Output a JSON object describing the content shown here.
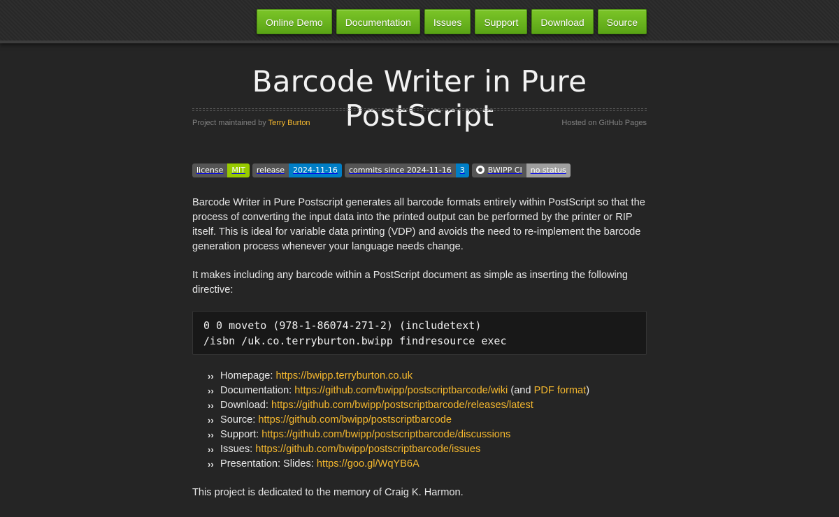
{
  "nav": [
    {
      "label": "Online Demo"
    },
    {
      "label": "Documentation"
    },
    {
      "label": "Issues"
    },
    {
      "label": "Support"
    },
    {
      "label": "Download"
    },
    {
      "label": "Source"
    }
  ],
  "header": {
    "title": "Barcode Writer in Pure PostScript",
    "maintained_prefix": "Project maintained by ",
    "maintainer": "Terry Burton",
    "hosted": "Hosted on GitHub Pages"
  },
  "badges": [
    {
      "key": "license",
      "value": "MIT",
      "color": "#97ca00"
    },
    {
      "key": "release",
      "value": "2024-11-16",
      "color": "#007ec6"
    },
    {
      "key": "commits since 2024-11-16",
      "value": "3",
      "color": "#007ec6"
    },
    {
      "key": "BWIPP CI",
      "value": "no status",
      "color": "#9f9f9f",
      "icon": "github-icon"
    }
  ],
  "intro": "Barcode Writer in Pure Postscript generates all barcode formats entirely within PostScript so that the process of converting the input data into the printed output can be performed by the printer or RIP itself. This is ideal for variable data printing (VDP) and avoids the need to re-implement the barcode generation process whenever your language needs change.",
  "directive_text": "It makes including any barcode within a PostScript document as simple as inserting the following directive:",
  "code": {
    "line1": "0 0 moveto (978-1-86074-271-2) (includetext)",
    "line2": "/isbn /uk.co.terryburton.bwipp findresource exec"
  },
  "links": {
    "bullet": "››",
    "homepage": {
      "label": "Homepage: ",
      "url": "https://bwipp.terryburton.co.uk"
    },
    "documentation": {
      "label": "Documentation: ",
      "url": "https://github.com/bwipp/postscriptbarcode/wiki",
      "mid": " (and ",
      "extra": "PDF format",
      "end": ")"
    },
    "download": {
      "label": "Download: ",
      "url": "https://github.com/bwipp/postscriptbarcode/releases/latest"
    },
    "source": {
      "label": "Source: ",
      "url": "https://github.com/bwipp/postscriptbarcode"
    },
    "support": {
      "label": "Support: ",
      "url": "https://github.com/bwipp/postscriptbarcode/discussions"
    },
    "issues": {
      "label": "Issues: ",
      "url": "https://github.com/bwipp/postscriptbarcode/issues"
    },
    "presentation": {
      "label": "Presentation: Slides: ",
      "url": "https://goo.gl/WqYB6A"
    }
  },
  "dedication": "This project is dedicated to the memory of Craig K. Harmon.",
  "colors": {
    "accent": "#f5b82e",
    "nav_green": "#6ab51f",
    "background": "#252525"
  }
}
